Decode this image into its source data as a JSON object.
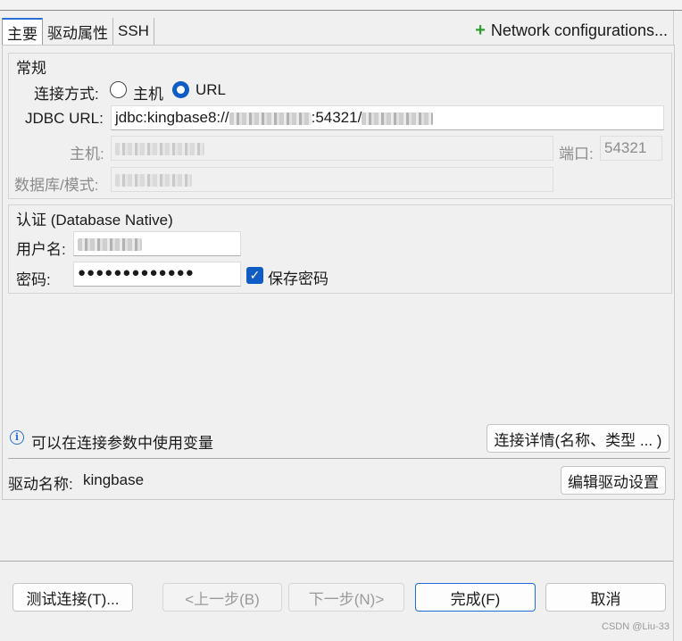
{
  "tabs": [
    {
      "label": "主要"
    },
    {
      "label": "驱动属性"
    },
    {
      "label": "SSH"
    }
  ],
  "network_config": {
    "label": "Network configurations..."
  },
  "general": {
    "title": "常规",
    "connect_method_label": "连接方式:",
    "radio_host": "主机",
    "radio_url": "URL",
    "jdbc_label": "JDBC URL:",
    "jdbc_prefix": "jdbc:kingbase8://",
    "jdbc_port_part": ":54321/",
    "host_label": "主机:",
    "port_label": "端口:",
    "port_value": "54321",
    "db_label": "数据库/模式:"
  },
  "auth": {
    "title": "认证 (Database Native)",
    "user_label": "用户名:",
    "password_label": "密码:",
    "password_value": "●●●●●●●●●●●●●",
    "save_password_label": "保存密码"
  },
  "info": {
    "text": "可以在连接参数中使用变量",
    "details_button": "连接详情(名称、类型 ... )"
  },
  "driver": {
    "label": "驱动名称:",
    "name": "kingbase",
    "edit_button": "编辑驱动设置"
  },
  "footer": {
    "test_button": "测试连接(T)...",
    "prev_button": "<上一步(B)",
    "next_button": "下一步(N)>",
    "finish_button": "完成(F)",
    "cancel_button": "取消"
  },
  "watermark": "CSDN @Liu-33",
  "colors": {
    "accent": "#0f5cc4",
    "plus_green": "#2e9e2e"
  }
}
